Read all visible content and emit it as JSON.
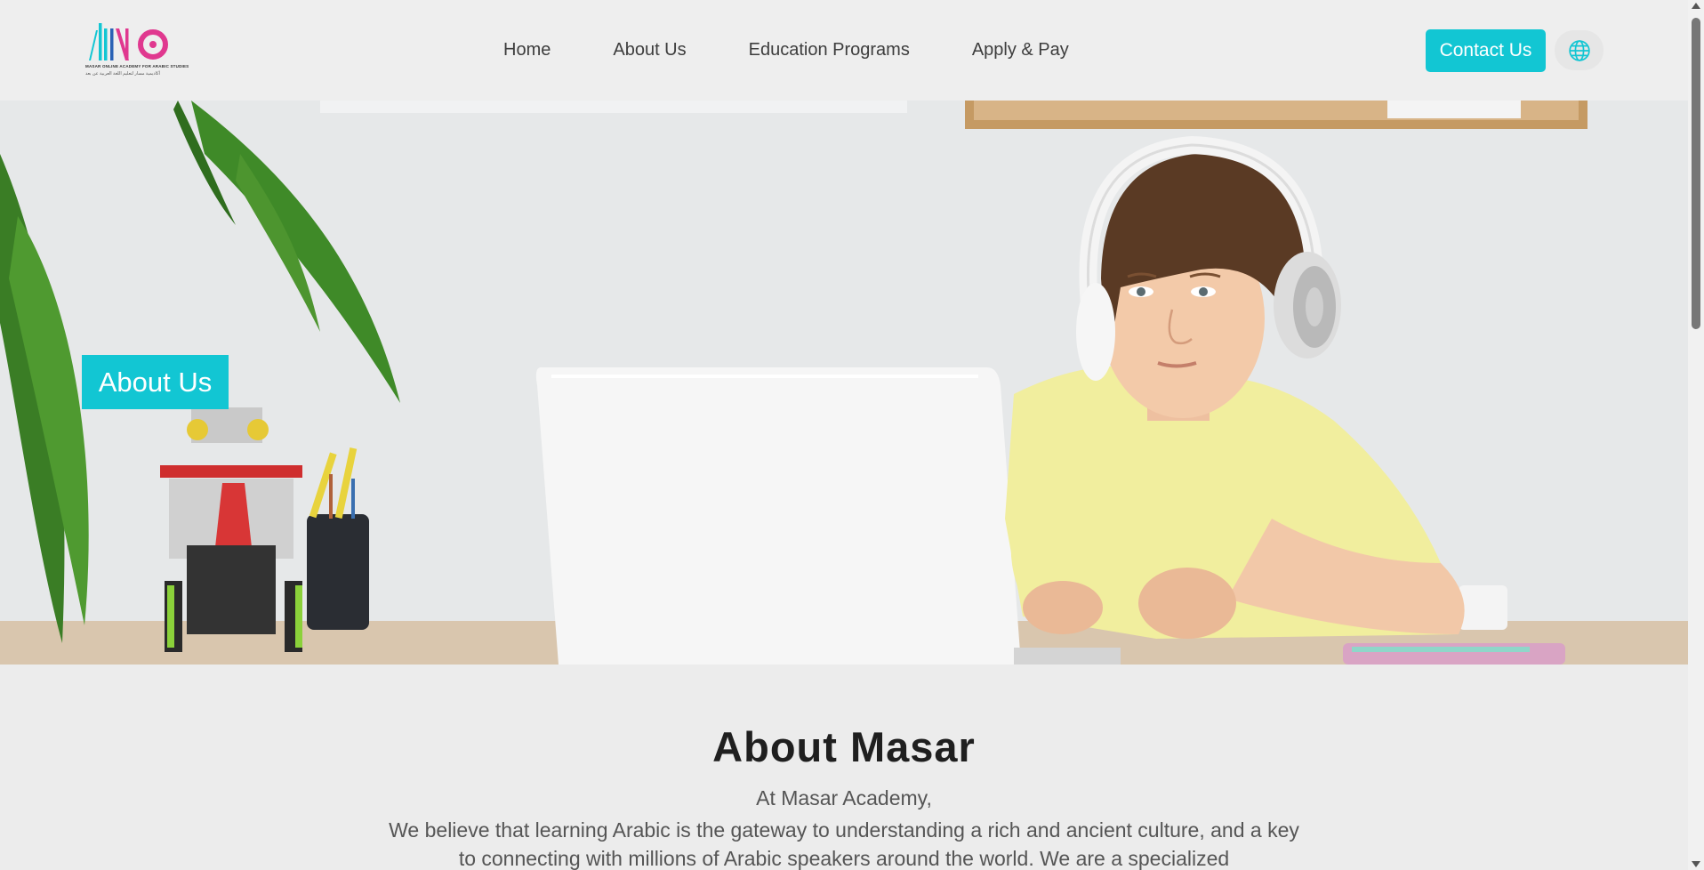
{
  "header": {
    "logo": {
      "mark": "AMO",
      "line1": "MASAR ONLINE ACADEMY FOR ARABIC STUDIES",
      "line2": "أكاديمية مسار لتعليم اللغة العربية عن بعد"
    },
    "nav": [
      "Home",
      "About Us",
      "Education Programs",
      "Apply & Pay"
    ],
    "contact_label": "Contact Us",
    "language_icon": "globe-icon"
  },
  "hero": {
    "badge": "About Us"
  },
  "about": {
    "title": "About Masar",
    "lead": "At Masar Academy,",
    "body": "We believe that learning Arabic is the gateway to understanding a rich and ancient culture, and a key to connecting with millions of Arabic speakers around the world. We are a specialized"
  },
  "colors": {
    "accent": "#12c6d3",
    "logo_pink": "#e0388f",
    "text_dark": "#1f1f1f",
    "text_muted": "#555555"
  }
}
